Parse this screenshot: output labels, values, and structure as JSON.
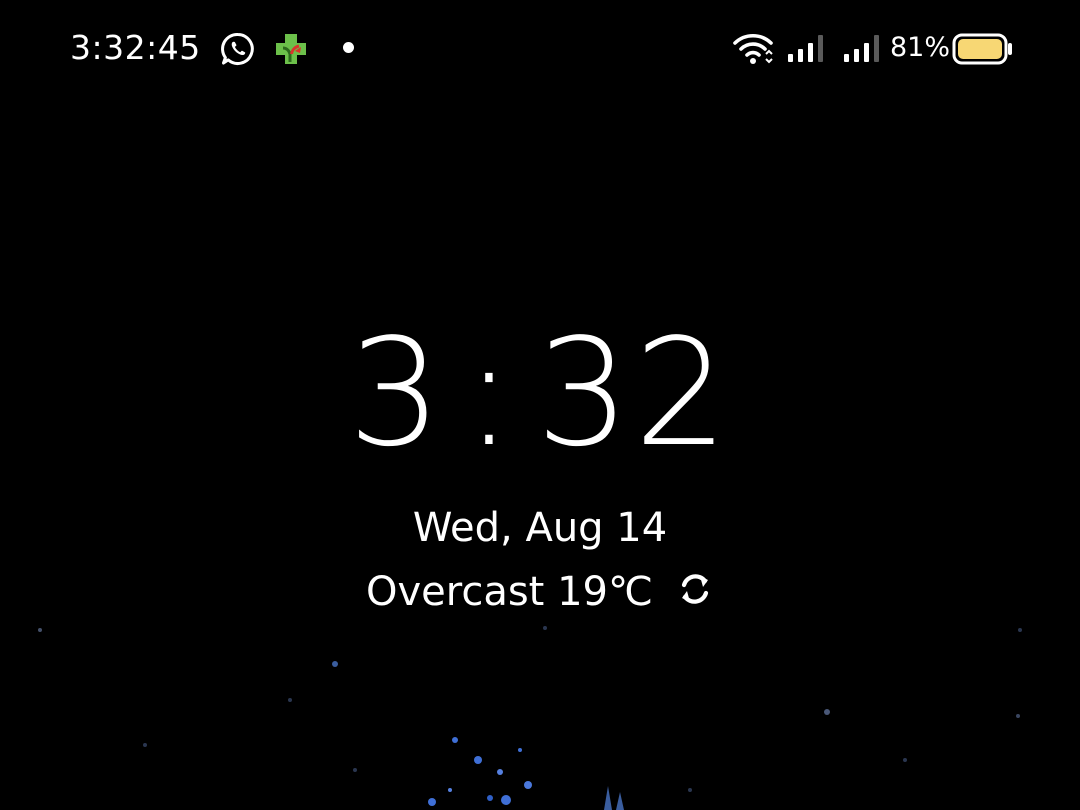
{
  "status_bar": {
    "time": "3:32:45",
    "notifications": [
      "whatsapp-icon",
      "health-app-icon",
      "more-notifications-dot"
    ],
    "wifi": "wifi-icon",
    "signal": [
      "signal-strength-sim1-icon",
      "signal-strength-sim2-icon"
    ],
    "battery_percent": "81%",
    "battery_level": 0.81,
    "battery_color": "#f7d774"
  },
  "lock_screen": {
    "hour": "3",
    "separator": ":",
    "minutes": "32",
    "date": "Wed, Aug 14",
    "weather": "Overcast 19℃",
    "weather_refresh_icon": "refresh-icon"
  },
  "colors": {
    "background": "#000000",
    "text": "#ffffff",
    "wallpaper_accent": "#3f6fd6",
    "health_icon_green": "#6cc04a",
    "health_icon_red": "#d9342b"
  }
}
